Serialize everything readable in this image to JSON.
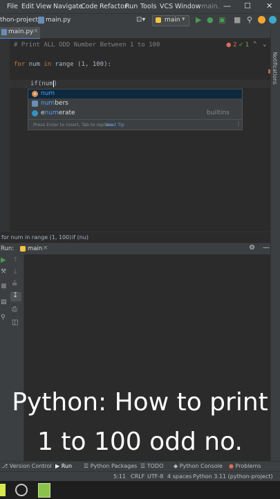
{
  "menu": {
    "items": [
      {
        "label": "File"
      },
      {
        "label": "Edit"
      },
      {
        "label": "View"
      },
      {
        "label": "Navigate"
      },
      {
        "label": "Code"
      },
      {
        "label": "Refactor"
      },
      {
        "label": "Run"
      },
      {
        "label": "Tools"
      },
      {
        "label": "VCS"
      },
      {
        "label": "Window"
      }
    ],
    "project_short": "main."
  },
  "nav": {
    "project": "thon-project",
    "file": "main.py",
    "run_config": "main"
  },
  "editor": {
    "tab": "main.py",
    "lines": [
      "# Print ALL ODD Number Between 1 to 100",
      "for num in range (1, 100):",
      "if(num)"
    ],
    "line2": {
      "kw": "for",
      "var": "num",
      "kw2": "in",
      "rest": "range (1, 100):"
    },
    "line3_prefix": "if(",
    "line3_arg": "num",
    "line3_suffix": ")",
    "warnings": "2",
    "checks": "1"
  },
  "completion": {
    "items": [
      {
        "label": "num",
        "prefix": "num",
        "rest": "",
        "kind": "v",
        "source": ""
      },
      {
        "label": "numbers",
        "prefix": "num",
        "rest": "bers",
        "kind": "p",
        "source": ""
      },
      {
        "label": "enumerate",
        "prefix": "e",
        "mid": "num",
        "rest": "erate",
        "kind": "c",
        "source": "builtins"
      }
    ],
    "hint": "Press Enter to insert, Tab to replace",
    "hint_link": "Next Tip"
  },
  "breadcrumb": {
    "a": "for num in range (1, 100)",
    "b": "if (nu)"
  },
  "run": {
    "label": "Run:",
    "tab": "main"
  },
  "overlay": {
    "line1": "Python: How to print",
    "line2": "1 to 100 odd no."
  },
  "bottom_tabs": [
    {
      "label": "Version Control"
    },
    {
      "label": "Run"
    },
    {
      "label": "Python Packages"
    },
    {
      "label": "TODO"
    },
    {
      "label": "Python Console"
    },
    {
      "label": "Problems"
    }
  ],
  "status": {
    "pos": "5:11",
    "eol": "CRLF",
    "enc": "UTF-8",
    "indent": "4 spaces",
    "interp": "Python 3.11 (python-project)"
  },
  "notifications": "Notifications",
  "colors": {
    "keyword": "#cc7832",
    "comment": "#808080",
    "number": "#6897bb",
    "selected": "#0d293e",
    "accent": "#589df6",
    "run_green": "#499c54"
  }
}
